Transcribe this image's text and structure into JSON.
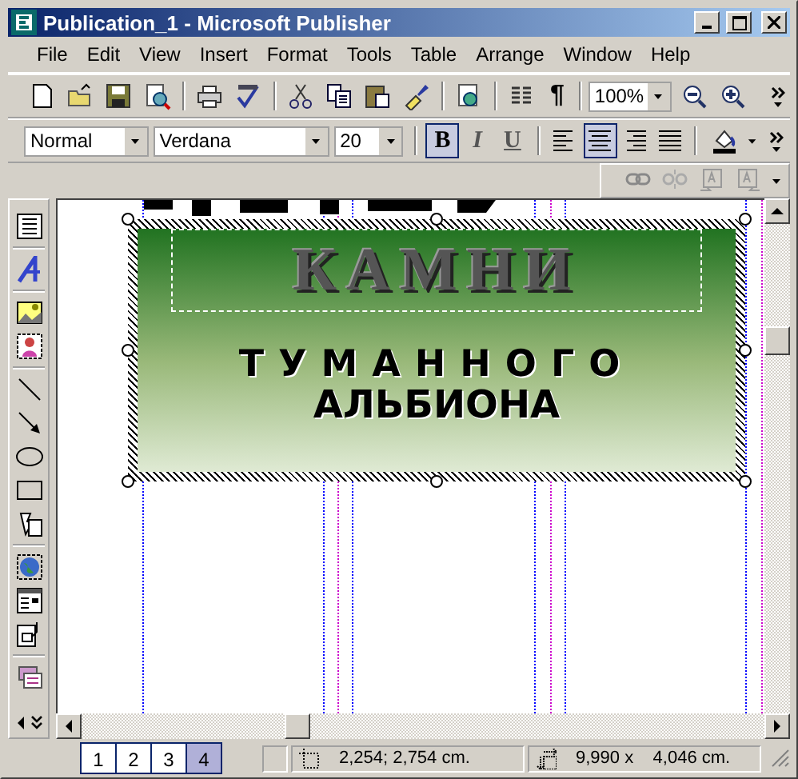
{
  "window": {
    "title": "Publication_1 - Microsoft Publisher"
  },
  "menu": [
    {
      "label": "File"
    },
    {
      "label": "Edit"
    },
    {
      "label": "View"
    },
    {
      "label": "Insert"
    },
    {
      "label": "Format"
    },
    {
      "label": "Tools"
    },
    {
      "label": "Table"
    },
    {
      "label": "Arrange"
    },
    {
      "label": "Window"
    },
    {
      "label": "Help"
    }
  ],
  "standard_toolbar": {
    "zoom": "100%",
    "show_marks": "¶"
  },
  "formatting_toolbar": {
    "style": "Normal",
    "font": "Verdana",
    "size": "20",
    "buttons": [
      {
        "kind": "bold",
        "label": "B",
        "selected": true
      },
      {
        "kind": "italic",
        "label": "I",
        "selected": false
      },
      {
        "kind": "underline",
        "label": "U",
        "selected": false
      },
      {
        "kind": "align-left",
        "selected": false
      },
      {
        "kind": "align-center",
        "selected": true
      },
      {
        "kind": "align-right",
        "selected": false
      },
      {
        "kind": "justify",
        "selected": false
      }
    ]
  },
  "document": {
    "title": "КАМНИ",
    "line_1": "ТУМАННОГО",
    "line_2": "АЛЬБИОНА"
  },
  "pages": [
    {
      "label": "1",
      "selected": false
    },
    {
      "label": "2",
      "selected": false
    },
    {
      "label": "3",
      "selected": false
    },
    {
      "label": "4",
      "selected": true
    }
  ],
  "status_bar": {
    "position": "2,254; 2,754 cm.",
    "size": "9,990 x    4,046 cm."
  }
}
